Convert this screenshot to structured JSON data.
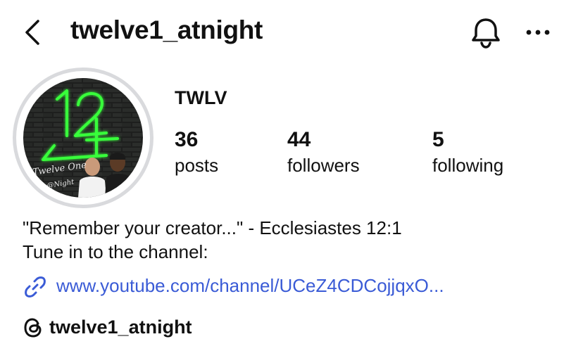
{
  "header": {
    "username": "twelve1_atnight",
    "back_icon": "chevron-left-icon",
    "bell_icon": "bell-icon",
    "more_icon": "more-horizontal-icon"
  },
  "profile": {
    "display_name": "TWLV",
    "avatar_logo_text": "Twelve One",
    "avatar_logo_sub": "@Night",
    "avatar_neon_number": "12",
    "stats": [
      {
        "value": "36",
        "label": "posts"
      },
      {
        "value": "44",
        "label": "followers"
      },
      {
        "value": "5",
        "label": "following"
      }
    ]
  },
  "bio": {
    "line1": "\"Remember your creator...\" - Ecclesiastes 12:1",
    "line2": "Tune in to the channel:",
    "link": "www.youtube.com/channel/UCeZ4CDCojjqxO..."
  },
  "threads": {
    "handle": "twelve1_atnight",
    "icon": "threads-icon"
  },
  "colors": {
    "link": "#3a5bd6",
    "neon_green": "#39ff3a",
    "ring": "#d9dadd"
  }
}
